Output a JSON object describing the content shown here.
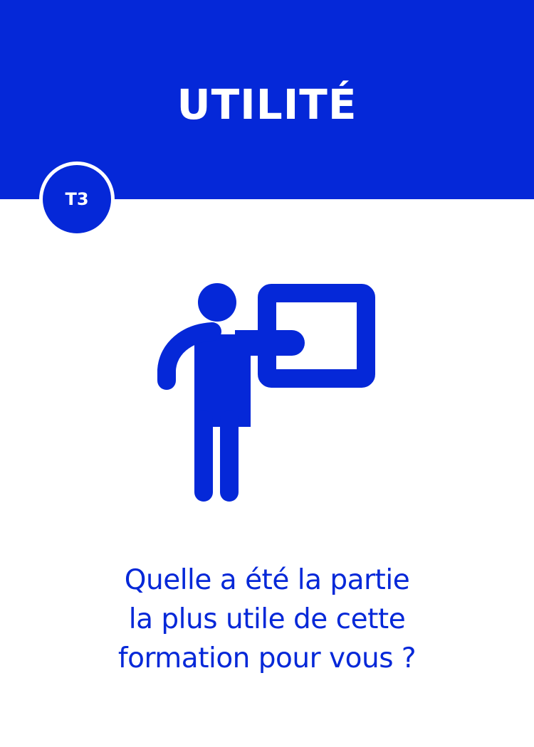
{
  "card": {
    "title": "UTILITÉ",
    "badge": "T3",
    "icon": "presenter-board-icon",
    "question_lines": [
      "Quelle a été la partie",
      "la plus utile de cette",
      "formation pour vous ?"
    ]
  },
  "colors": {
    "primary": "#0528d8",
    "background": "#ffffff"
  }
}
